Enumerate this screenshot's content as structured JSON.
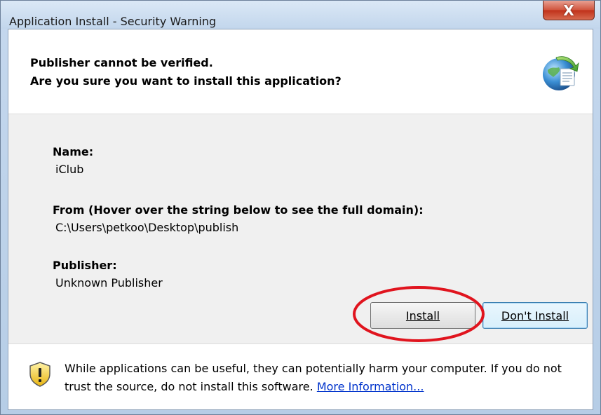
{
  "window": {
    "title": "Application Install - Security Warning",
    "close_glyph": "X"
  },
  "header": {
    "line1": "Publisher cannot be verified.",
    "line2": "Are you sure you want to install this application?",
    "icon": "globe-document-icon"
  },
  "details": {
    "name_label": "Name:",
    "name_value": "iClub",
    "from_label": "From (Hover over the string below to see the full domain):",
    "from_value": "C:\\Users\\petkoo\\Desktop\\publish",
    "publisher_label": "Publisher:",
    "publisher_value": "Unknown Publisher"
  },
  "buttons": {
    "install": "Install",
    "dont_install": "Don't Install"
  },
  "footer": {
    "warning_text": "While applications can be useful, they can potentially harm your computer. If you do not trust the source, do not install this software.",
    "more_info_link": "More Information...",
    "icon": "warning-shield-icon"
  },
  "annotation": {
    "color": "#e0141e"
  }
}
